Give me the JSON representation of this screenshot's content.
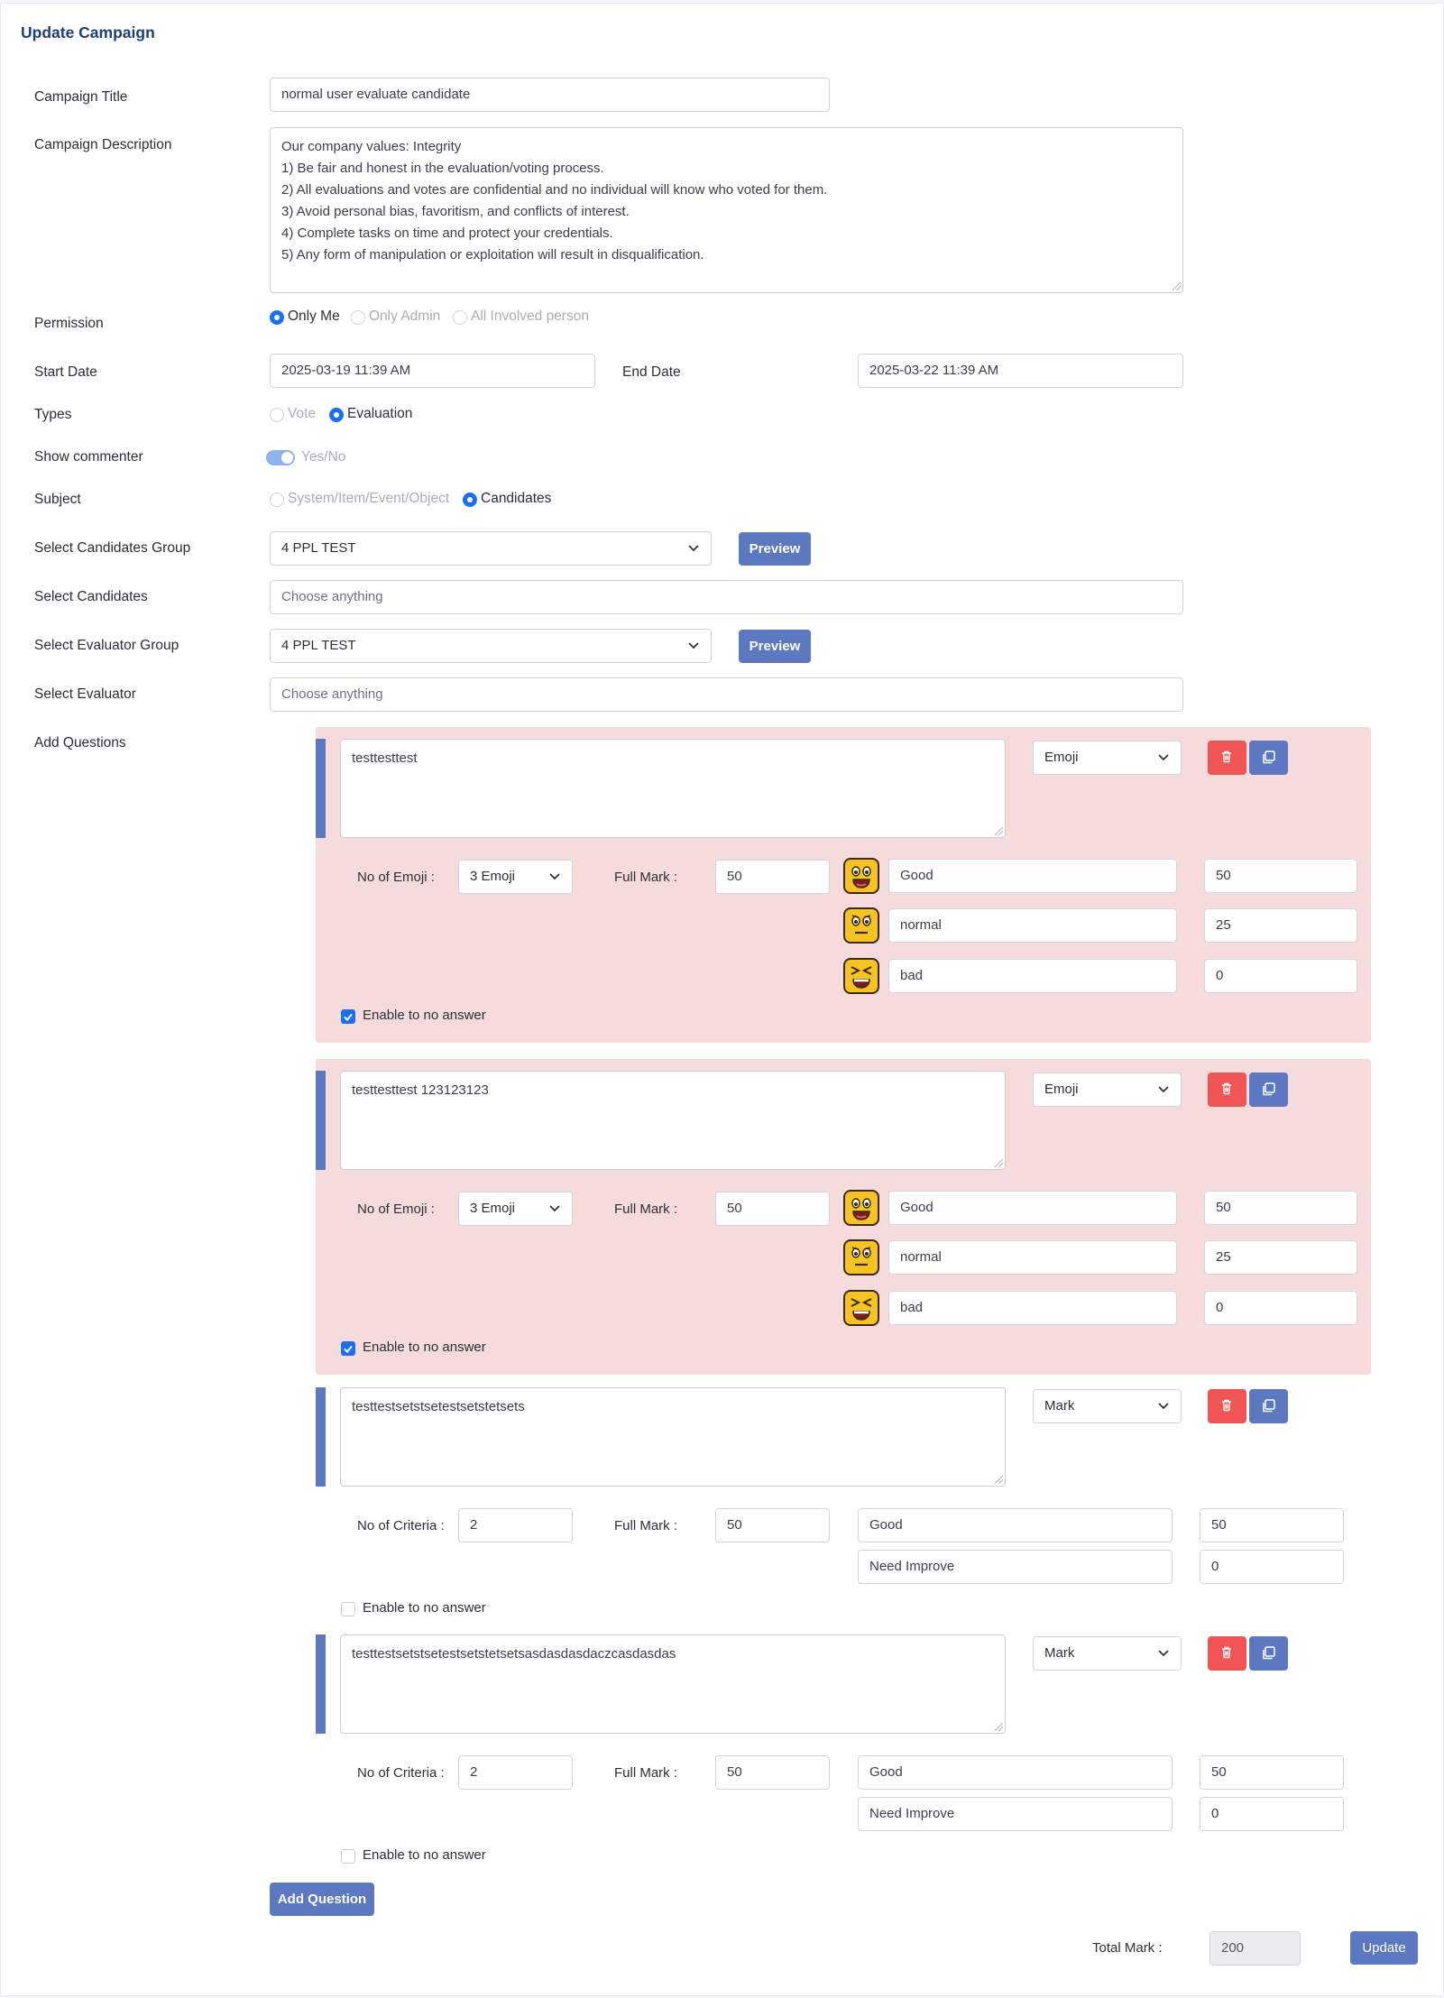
{
  "page": {
    "title": "Update Campaign"
  },
  "form": {
    "campaign_title_label": "Campaign Title",
    "campaign_title_value": "normal user evaluate candidate",
    "description_label": "Campaign Description",
    "description_lines": [
      "Our company values: Integrity",
      "1) Be fair and honest in the evaluation/voting process.",
      "2) All evaluations and votes are confidential and no individual will know who voted for them.",
      "3) Avoid personal bias, favoritism, and conflicts of interest.",
      "4) Complete tasks on time and protect your credentials.",
      "5) Any form of manipulation or exploitation will result in disqualification."
    ],
    "permission_label": "Permission",
    "permission_options": [
      "Only Me",
      "Only Admin",
      "All Involved person"
    ],
    "start_date_label": "Start Date",
    "start_date_value": "2025-03-19 11:39 AM",
    "end_date_label": "End Date",
    "end_date_value": "2025-03-22 11:39 AM",
    "types_label": "Types",
    "types_options": [
      "Vote",
      "Evaluation"
    ],
    "show_commenter_label": "Show commenter",
    "show_commenter_toggle": "Yes/No",
    "subject_label": "Subject",
    "subject_options": [
      "System/Item/Event/Object",
      "Candidates"
    ],
    "cand_group_label": "Select Candidates Group",
    "cand_group_value": "4 PPL TEST",
    "preview_label": "Preview",
    "cand_label": "Select Candidates",
    "cand_placeholder": "Choose anything",
    "eval_group_label": "Select Evaluator Group",
    "eval_group_value": "4 PPL TEST",
    "eval_label": "Select Evaluator",
    "eval_placeholder": "Choose anything",
    "add_questions_label": "Add Questions"
  },
  "questions": [
    {
      "text": "testtesttest",
      "type": "Emoji",
      "count_label": "No of Emoji :",
      "count_value": "3 Emoji",
      "full_mark_label": "Full Mark :",
      "full_mark": "50",
      "rows": [
        [
          "Good",
          "50"
        ],
        [
          "normal",
          "25"
        ],
        [
          "bad",
          "0"
        ]
      ],
      "no_answer_label": "Enable to no answer",
      "no_answer_checked": true
    },
    {
      "text": "testtesttest 123123123",
      "type": "Emoji",
      "count_label": "No of Emoji :",
      "count_value": "3 Emoji",
      "full_mark_label": "Full Mark :",
      "full_mark": "50",
      "rows": [
        [
          "Good",
          "50"
        ],
        [
          "normal",
          "25"
        ],
        [
          "bad",
          "0"
        ]
      ],
      "no_answer_label": "Enable to no answer",
      "no_answer_checked": true
    },
    {
      "text": "testtestsetstsetestsetstetsets",
      "type": "Mark",
      "count_label": "No of Criteria :",
      "count_value": "2",
      "full_mark_label": "Full Mark :",
      "full_mark": "50",
      "rows": [
        [
          "Good",
          "50"
        ],
        [
          "Need Improve",
          "0"
        ]
      ],
      "no_answer_label": "Enable to no answer",
      "no_answer_checked": false
    },
    {
      "text": "testtestsetstsetestsetstetsetsasdasdasdaczcasdasdas",
      "type": "Mark",
      "count_label": "No of Criteria :",
      "count_value": "2",
      "full_mark_label": "Full Mark :",
      "full_mark": "50",
      "rows": [
        [
          "Good",
          "50"
        ],
        [
          "Need Improve",
          "0"
        ]
      ],
      "no_answer_label": "Enable to no answer",
      "no_answer_checked": false
    }
  ],
  "footer": {
    "add_question_label": "Add Question",
    "total_mark_label": "Total Mark :",
    "total_mark_value": "200",
    "update_label": "Update"
  },
  "colors": {
    "accent": "#5b78c1",
    "radio": "#1a6ff2",
    "delete": "#f05454",
    "emoji_bg": "#f6dbdd"
  }
}
